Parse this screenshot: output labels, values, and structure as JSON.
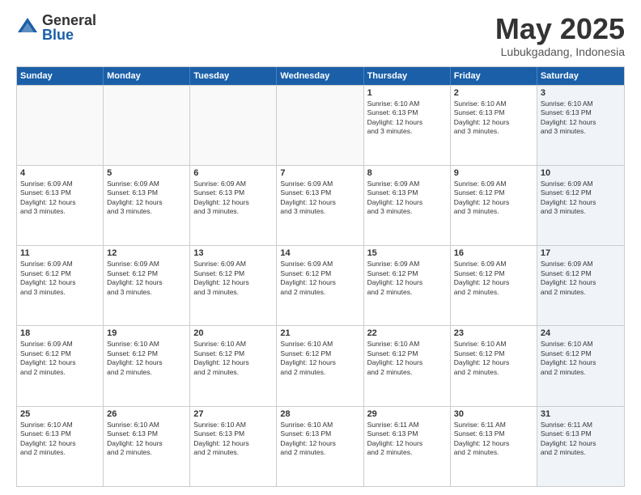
{
  "header": {
    "logo_general": "General",
    "logo_blue": "Blue",
    "title": "May 2025",
    "subtitle": "Lubukgadang, Indonesia"
  },
  "days_of_week": [
    "Sunday",
    "Monday",
    "Tuesday",
    "Wednesday",
    "Thursday",
    "Friday",
    "Saturday"
  ],
  "weeks": [
    [
      {
        "day": "",
        "info": ""
      },
      {
        "day": "",
        "info": ""
      },
      {
        "day": "",
        "info": ""
      },
      {
        "day": "",
        "info": ""
      },
      {
        "day": "1",
        "info": "Sunrise: 6:10 AM\nSunset: 6:13 PM\nDaylight: 12 hours\nand 3 minutes."
      },
      {
        "day": "2",
        "info": "Sunrise: 6:10 AM\nSunset: 6:13 PM\nDaylight: 12 hours\nand 3 minutes."
      },
      {
        "day": "3",
        "info": "Sunrise: 6:10 AM\nSunset: 6:13 PM\nDaylight: 12 hours\nand 3 minutes."
      }
    ],
    [
      {
        "day": "4",
        "info": "Sunrise: 6:09 AM\nSunset: 6:13 PM\nDaylight: 12 hours\nand 3 minutes."
      },
      {
        "day": "5",
        "info": "Sunrise: 6:09 AM\nSunset: 6:13 PM\nDaylight: 12 hours\nand 3 minutes."
      },
      {
        "day": "6",
        "info": "Sunrise: 6:09 AM\nSunset: 6:13 PM\nDaylight: 12 hours\nand 3 minutes."
      },
      {
        "day": "7",
        "info": "Sunrise: 6:09 AM\nSunset: 6:13 PM\nDaylight: 12 hours\nand 3 minutes."
      },
      {
        "day": "8",
        "info": "Sunrise: 6:09 AM\nSunset: 6:13 PM\nDaylight: 12 hours\nand 3 minutes."
      },
      {
        "day": "9",
        "info": "Sunrise: 6:09 AM\nSunset: 6:12 PM\nDaylight: 12 hours\nand 3 minutes."
      },
      {
        "day": "10",
        "info": "Sunrise: 6:09 AM\nSunset: 6:12 PM\nDaylight: 12 hours\nand 3 minutes."
      }
    ],
    [
      {
        "day": "11",
        "info": "Sunrise: 6:09 AM\nSunset: 6:12 PM\nDaylight: 12 hours\nand 3 minutes."
      },
      {
        "day": "12",
        "info": "Sunrise: 6:09 AM\nSunset: 6:12 PM\nDaylight: 12 hours\nand 3 minutes."
      },
      {
        "day": "13",
        "info": "Sunrise: 6:09 AM\nSunset: 6:12 PM\nDaylight: 12 hours\nand 3 minutes."
      },
      {
        "day": "14",
        "info": "Sunrise: 6:09 AM\nSunset: 6:12 PM\nDaylight: 12 hours\nand 2 minutes."
      },
      {
        "day": "15",
        "info": "Sunrise: 6:09 AM\nSunset: 6:12 PM\nDaylight: 12 hours\nand 2 minutes."
      },
      {
        "day": "16",
        "info": "Sunrise: 6:09 AM\nSunset: 6:12 PM\nDaylight: 12 hours\nand 2 minutes."
      },
      {
        "day": "17",
        "info": "Sunrise: 6:09 AM\nSunset: 6:12 PM\nDaylight: 12 hours\nand 2 minutes."
      }
    ],
    [
      {
        "day": "18",
        "info": "Sunrise: 6:09 AM\nSunset: 6:12 PM\nDaylight: 12 hours\nand 2 minutes."
      },
      {
        "day": "19",
        "info": "Sunrise: 6:10 AM\nSunset: 6:12 PM\nDaylight: 12 hours\nand 2 minutes."
      },
      {
        "day": "20",
        "info": "Sunrise: 6:10 AM\nSunset: 6:12 PM\nDaylight: 12 hours\nand 2 minutes."
      },
      {
        "day": "21",
        "info": "Sunrise: 6:10 AM\nSunset: 6:12 PM\nDaylight: 12 hours\nand 2 minutes."
      },
      {
        "day": "22",
        "info": "Sunrise: 6:10 AM\nSunset: 6:12 PM\nDaylight: 12 hours\nand 2 minutes."
      },
      {
        "day": "23",
        "info": "Sunrise: 6:10 AM\nSunset: 6:12 PM\nDaylight: 12 hours\nand 2 minutes."
      },
      {
        "day": "24",
        "info": "Sunrise: 6:10 AM\nSunset: 6:12 PM\nDaylight: 12 hours\nand 2 minutes."
      }
    ],
    [
      {
        "day": "25",
        "info": "Sunrise: 6:10 AM\nSunset: 6:13 PM\nDaylight: 12 hours\nand 2 minutes."
      },
      {
        "day": "26",
        "info": "Sunrise: 6:10 AM\nSunset: 6:13 PM\nDaylight: 12 hours\nand 2 minutes."
      },
      {
        "day": "27",
        "info": "Sunrise: 6:10 AM\nSunset: 6:13 PM\nDaylight: 12 hours\nand 2 minutes."
      },
      {
        "day": "28",
        "info": "Sunrise: 6:10 AM\nSunset: 6:13 PM\nDaylight: 12 hours\nand 2 minutes."
      },
      {
        "day": "29",
        "info": "Sunrise: 6:11 AM\nSunset: 6:13 PM\nDaylight: 12 hours\nand 2 minutes."
      },
      {
        "day": "30",
        "info": "Sunrise: 6:11 AM\nSunset: 6:13 PM\nDaylight: 12 hours\nand 2 minutes."
      },
      {
        "day": "31",
        "info": "Sunrise: 6:11 AM\nSunset: 6:13 PM\nDaylight: 12 hours\nand 2 minutes."
      }
    ]
  ]
}
